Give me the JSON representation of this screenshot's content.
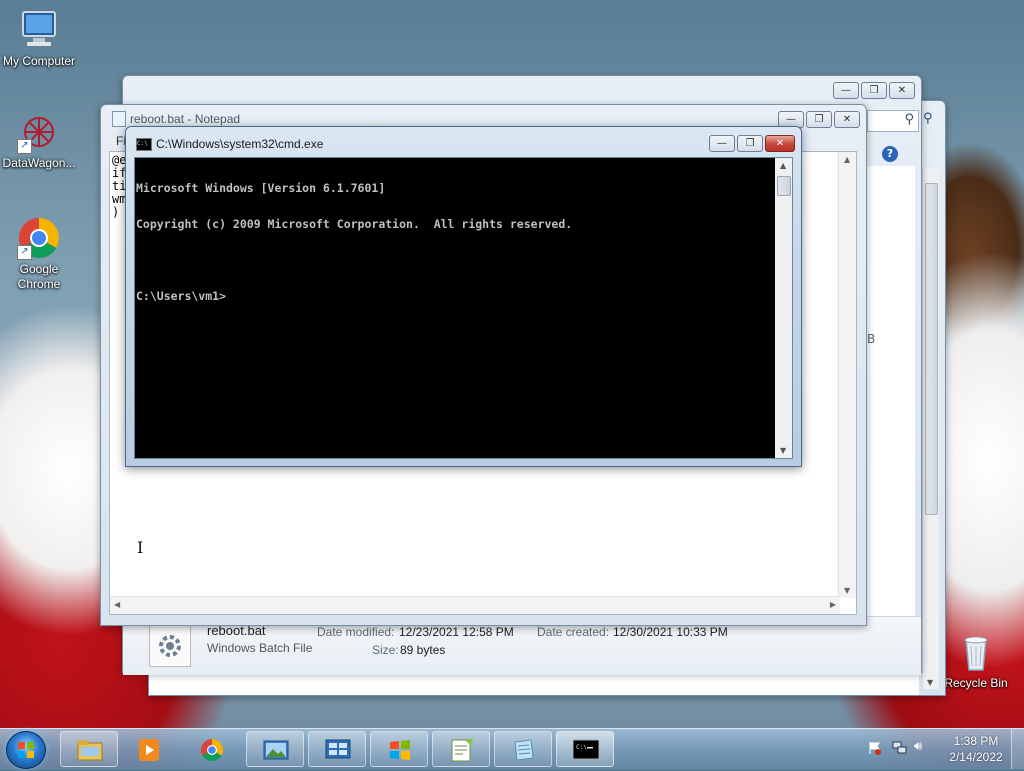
{
  "desktop": {
    "icons": [
      {
        "label": "My Computer"
      },
      {
        "label": "DataWagon..."
      },
      {
        "label": "Google Chrome"
      },
      {
        "label": "Recycle Bin"
      }
    ]
  },
  "explorer": {
    "file": {
      "name": "reboot.bat",
      "type": "Windows Batch File",
      "date_modified_label": "Date modified:",
      "date_modified": "12/23/2021 12:58 PM",
      "date_created_label": "Date created:",
      "date_created": "12/30/2021 10:33 PM",
      "size_label": "Size:",
      "size": "89 bytes"
    },
    "partial_text": "B"
  },
  "notepad": {
    "title": "reboot.bat - Notepad",
    "menu_partial": "Fi",
    "text_lines": [
      "@e",
      "if",
      "ti",
      "wm",
      ")"
    ]
  },
  "cmd": {
    "title": "C:\\Windows\\system32\\cmd.exe",
    "lines": [
      "Microsoft Windows [Version 6.1.7601]",
      "Copyright (c) 2009 Microsoft Corporation.  All rights reserved.",
      "",
      "C:\\Users\\vm1>"
    ]
  },
  "taskbar": {
    "clock_time": "1:38 PM",
    "clock_date": "2/14/2022",
    "items": [
      "windows-explorer",
      "media-player",
      "google-chrome",
      "image-viewer",
      "control-panel",
      "windows-update",
      "notepad-plus-plus",
      "notepad",
      "command-prompt"
    ]
  },
  "colors": {
    "cmd_bg": "#000000",
    "cmd_fg": "#c0c0c0",
    "close_red": "#c7453a"
  }
}
